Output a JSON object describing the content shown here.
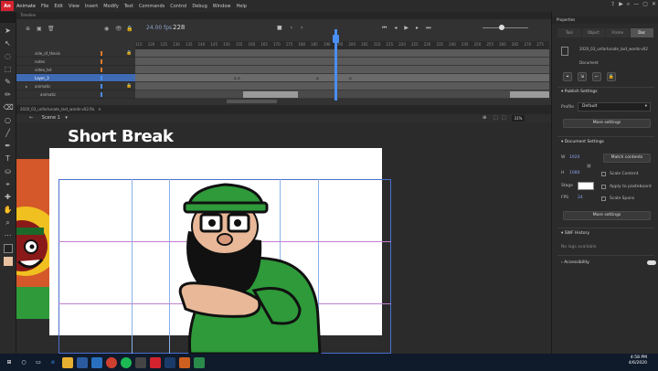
{
  "app": {
    "name": "Animate",
    "menu": [
      "File",
      "Edit",
      "View",
      "Insert",
      "Modify",
      "Text",
      "Commands",
      "Control",
      "Debug",
      "Window",
      "Help"
    ]
  },
  "timeline": {
    "panel_title": "Timeline",
    "fps": "24.00",
    "fps_unit": "fps",
    "current_frame": "228",
    "ruler_ticks": [
      "115",
      "120",
      "125",
      "130",
      "135",
      "140",
      "145",
      "150",
      "155",
      "160",
      "165",
      "170",
      "175",
      "180",
      "185",
      "190",
      "195",
      "200",
      "205",
      "210",
      "215",
      "220",
      "225",
      "230",
      "235",
      "240",
      "245",
      "250",
      "255",
      "260",
      "265",
      "270",
      "275"
    ],
    "layers": [
      {
        "name": "side_of_thesis",
        "color": "#e07a2a",
        "selected": false
      },
      {
        "name": "notes",
        "color": "#e07a2a",
        "selected": false
      },
      {
        "name": "video_txt",
        "color": "#e07a2a",
        "selected": false
      },
      {
        "name": "Layer_3",
        "color": "#4a8ef0",
        "selected": true
      },
      {
        "name": "animatic",
        "color": "#4a8ef0",
        "selected": false
      },
      {
        "name": "animatic",
        "color": "#4a8ef0",
        "selected": false
      }
    ]
  },
  "document": {
    "filename": "2020_03_unfortunate_last_words-v02.fla",
    "scene": "Scene 1",
    "zoom": "31%"
  },
  "stage": {
    "title_text": "Short Break"
  },
  "properties": {
    "panel_title": "Properties",
    "tabs": [
      "Tool",
      "Object",
      "Frame",
      "Doc"
    ],
    "doc_name": "2020_03_unfortunate_last_words-v02",
    "doc_type": "Document",
    "publish_title": "Publish Settings",
    "profile_label": "Profile",
    "profile_value": "Default",
    "more_settings": "More settings",
    "doc_settings_title": "Document Settings",
    "width_label": "W",
    "width_value": "1920",
    "height_label": "H",
    "height_value": "1080",
    "match_contents": "Match contents",
    "scale_content": "Scale Content",
    "stage_label": "Stage",
    "apply_pasteboard": "Apply to pasteboard",
    "fps_label": "FPS",
    "fps_value": "24",
    "scale_spans": "Scale Spans",
    "more_settings_2": "More settings",
    "swf_history_title": "SWF History",
    "no_logs": "No logs available",
    "accessibility_title": "Accessibility"
  },
  "taskbar": {
    "time": "4:58 PM",
    "date": "4/6/2020"
  }
}
